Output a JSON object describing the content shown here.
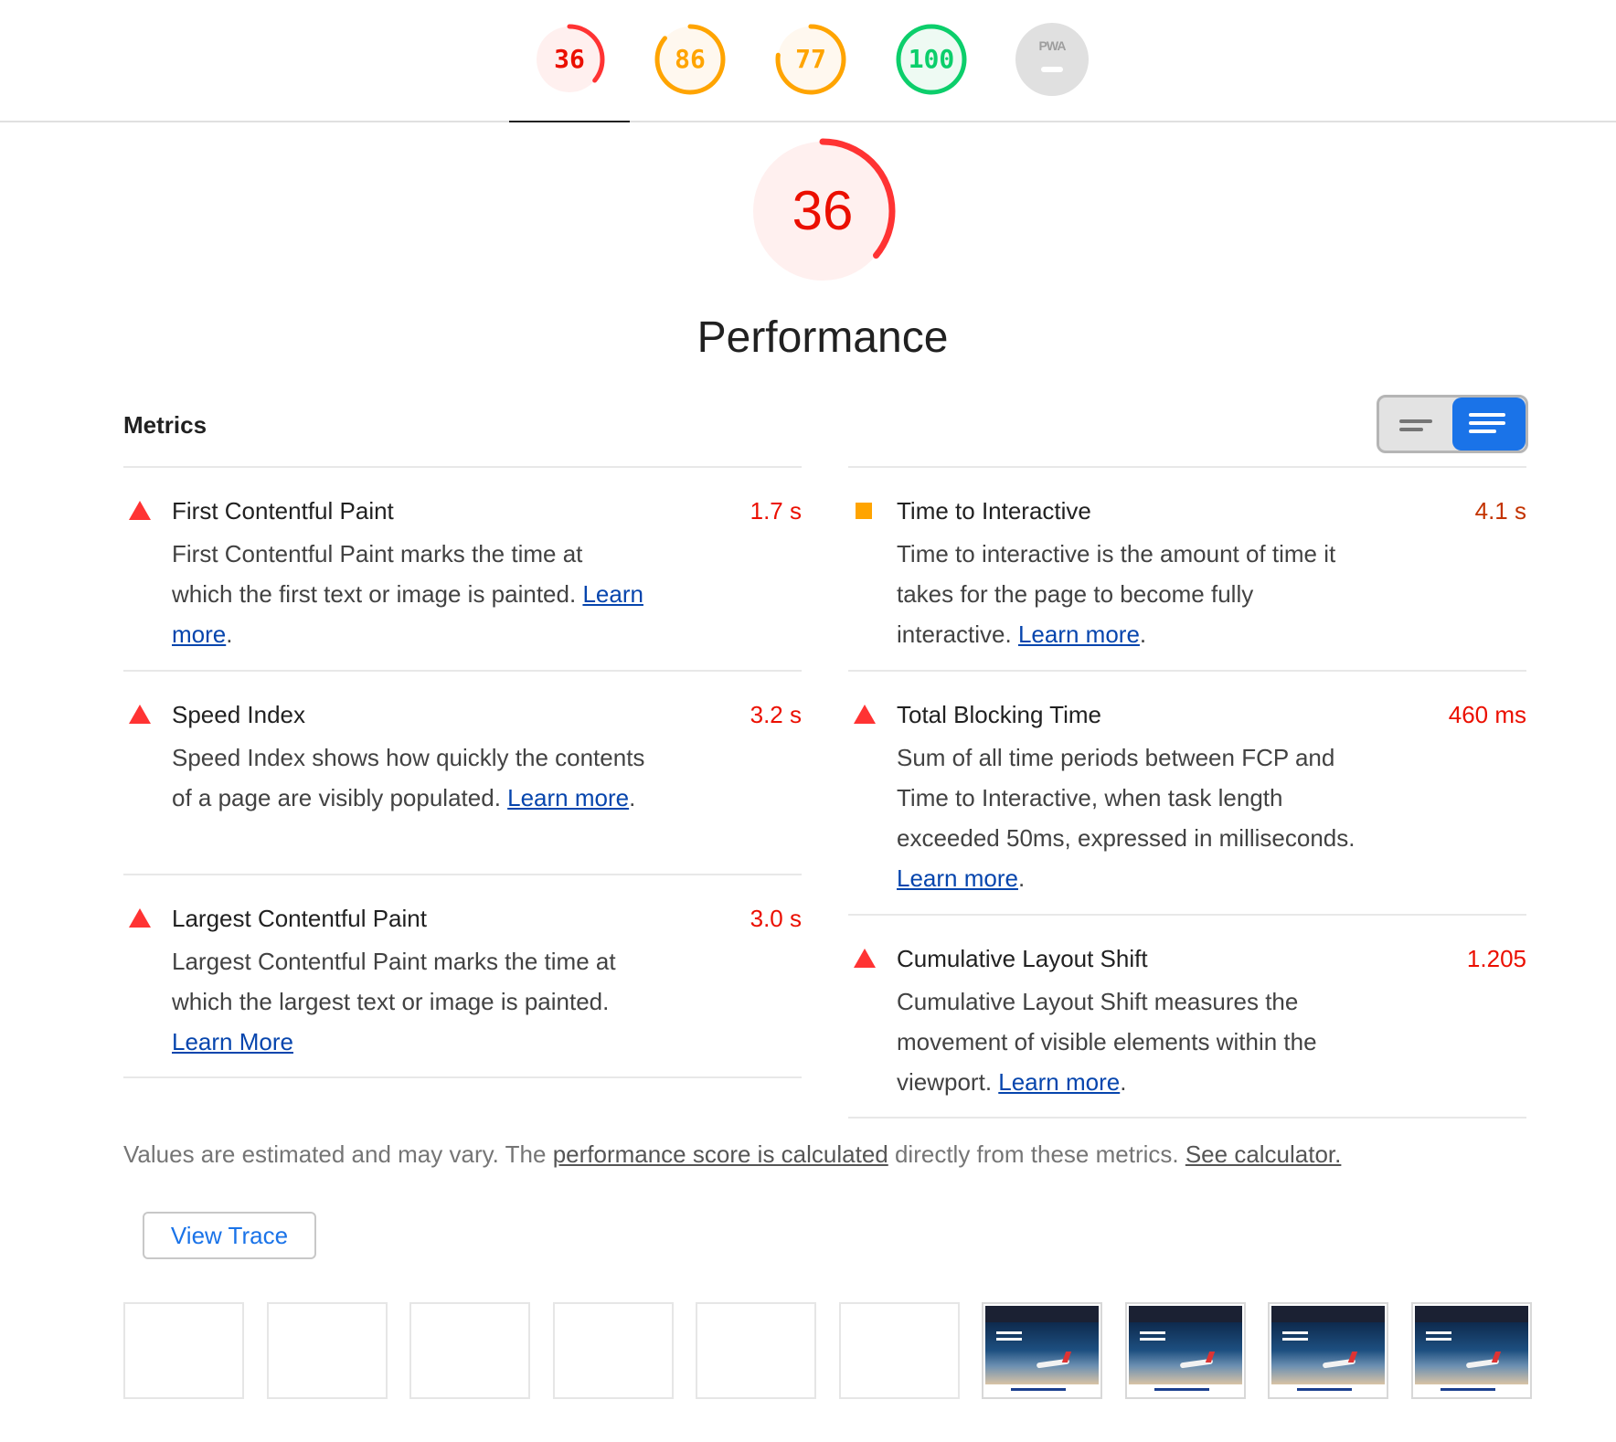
{
  "score_tabs": [
    {
      "score": "36",
      "color": "#ff3333",
      "bg": "#fff0ef",
      "fraction": 0.36,
      "active": true
    },
    {
      "score": "86",
      "color": "#ffa400",
      "bg": "#fff8ef",
      "fraction": 0.86,
      "active": false
    },
    {
      "score": "77",
      "color": "#ffa400",
      "bg": "#fff8ef",
      "fraction": 0.77,
      "active": false
    },
    {
      "score": "100",
      "color": "#0cce6b",
      "bg": "#eefaf3",
      "fraction": 1.0,
      "active": false
    },
    {
      "score": "PWA",
      "color": "#9e9e9e",
      "bg": "#e0e0e0",
      "fraction": 0,
      "active": false
    }
  ],
  "performance": {
    "score": "36",
    "fraction": 0.36,
    "title": "Performance",
    "color": "#ff3333"
  },
  "metrics_title": "Metrics",
  "metrics": [
    {
      "icon": "triangle-fail-icon",
      "title": "First Contentful Paint",
      "value": "1.7 s",
      "status": "fail",
      "desc": "First Contentful Paint marks the time at which the first text or image is painted. ",
      "link": "Learn more",
      "after": "."
    },
    {
      "icon": "square-average-icon",
      "title": "Time to Interactive",
      "value": "4.1 s",
      "status": "average",
      "desc": "Time to interactive is the amount of time it takes for the page to become fully interactive. ",
      "link": "Learn more",
      "after": "."
    },
    {
      "icon": "triangle-fail-icon",
      "title": "Speed Index",
      "value": "3.2 s",
      "status": "fail",
      "desc": "Speed Index shows how quickly the contents of a page are visibly populated. ",
      "link": "Learn more",
      "after": "."
    },
    {
      "icon": "triangle-fail-icon",
      "title": "Total Blocking Time",
      "value": "460 ms",
      "status": "fail",
      "desc": "Sum of all time periods between FCP and Time to Interactive, when task length exceeded 50ms, expressed in milliseconds. ",
      "link": "Learn more",
      "after": "."
    },
    {
      "icon": "triangle-fail-icon",
      "title": "Largest Contentful Paint",
      "value": "3.0 s",
      "status": "fail",
      "desc": "Largest Contentful Paint marks the time at which the largest text or image is painted. ",
      "link": "Learn More",
      "after": ""
    },
    {
      "icon": "triangle-fail-icon",
      "title": "Cumulative Layout Shift",
      "value": "1.205",
      "status": "fail",
      "desc": "Cumulative Layout Shift measures the movement of visible elements within the viewport. ",
      "link": "Learn more",
      "after": "."
    }
  ],
  "footer": {
    "pre": "Values are estimated and may vary. The ",
    "link1": "performance score is calculated",
    "mid": " directly from these metrics. ",
    "link2": "See calculator."
  },
  "view_trace_label": "View Trace",
  "filmstrip": [
    "blank",
    "blank",
    "blank",
    "blank",
    "blank",
    "blank",
    "screenshot",
    "screenshot",
    "screenshot",
    "screenshot"
  ]
}
